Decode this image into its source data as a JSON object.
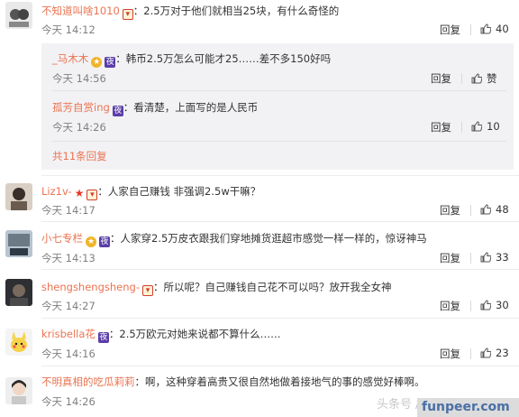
{
  "comments": [
    {
      "username": "不知道叫啥1010",
      "sep": "：",
      "text": "2.5万对于他们就相当25块，有什么奇怪的",
      "time": "今天 14:12",
      "reply": "回复",
      "likes": "40"
    },
    {
      "username": "Liz1v-",
      "sep": "：",
      "text": "人家自己赚钱 非强调2.5w干嘛？",
      "time": "今天 14:17",
      "reply": "回复",
      "likes": "48"
    },
    {
      "username": "小七专栏",
      "sep": "：",
      "text": "人家穿2.5万皮衣跟我们穿地摊货逛超市感觉一样一样的，惊讶神马",
      "time": "今天 14:13",
      "reply": "回复",
      "likes": "33"
    },
    {
      "username": "shengshengsheng-",
      "sep": "：",
      "text": "所以呢？自己赚钱自己花不可以吗？放开我全女神",
      "time": "今天 14:27",
      "reply": "回复",
      "likes": "30"
    },
    {
      "username": "krisbella花",
      "sep": "：",
      "text": "2.5万欧元对她来说都不算什么……",
      "time": "今天 14:16",
      "reply": "回复",
      "likes": "23"
    },
    {
      "username": "不明真相的吃瓜莉莉",
      "sep": "：",
      "text": "啊，这种穿着高贵又很自然地做着接地气的事的感觉好棒啊。",
      "time": "今天 14:26",
      "reply": "回复",
      "likes": ""
    }
  ],
  "sub_replies": [
    {
      "username": "_马木木",
      "sep": "：",
      "text": "韩币2.5万怎么可能才25……差不多150好吗",
      "time": "今天 14:56",
      "reply": "回复",
      "likes": "赞"
    },
    {
      "username": "孤芳自赏ing",
      "sep": "：",
      "text": "看清楚，上面写的是人民币",
      "time": "今天 14:26",
      "reply": "回复",
      "likes": "10"
    }
  ],
  "more_replies": "共11条回复",
  "badges": {
    "night": "夜"
  },
  "watermark": {
    "site": "funpeer.com",
    "faint": "头条号 / 网趣资讯"
  },
  "colors": {
    "username": "#eb7350",
    "time": "#808080",
    "subbox": "#f2f2f5"
  }
}
